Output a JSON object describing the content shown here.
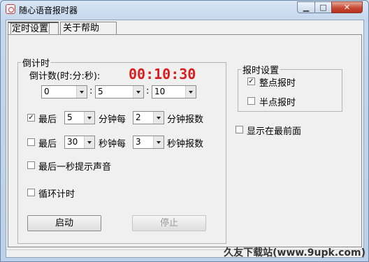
{
  "window": {
    "title": "随心语音报时器"
  },
  "tabs": [
    {
      "label": "定时设置"
    },
    {
      "label": "关于帮助"
    }
  ],
  "countdown": {
    "group_label": "倒计时",
    "format_label": "倒计数(时:分:秒):",
    "timer_display": "00:10:30",
    "hours": "0",
    "minutes": "5",
    "seconds": "10",
    "sep": ":"
  },
  "rules": {
    "last_min": {
      "checked": true,
      "prefix": "最后",
      "value": "5",
      "mid": "分钟每",
      "interval": "2",
      "suffix": "分钟报数"
    },
    "last_sec": {
      "checked": false,
      "prefix": "最后",
      "value": "30",
      "mid": "秒钟每",
      "interval": "3",
      "suffix": "秒钟报数"
    },
    "last_second_sound": {
      "checked": false,
      "label": "最后一秒提示声音"
    },
    "loop": {
      "checked": false,
      "label": "循环计时"
    }
  },
  "buttons": {
    "start": "启动",
    "stop": "停止"
  },
  "report": {
    "group_label": "报时设置",
    "hourly": {
      "checked": true,
      "label": "整点报时"
    },
    "half_hour": {
      "checked": false,
      "label": "半点报时"
    }
  },
  "topmost": {
    "checked": false,
    "label": "显示在最前面"
  },
  "watermark": "久友下载站(www.9upk.com)"
}
